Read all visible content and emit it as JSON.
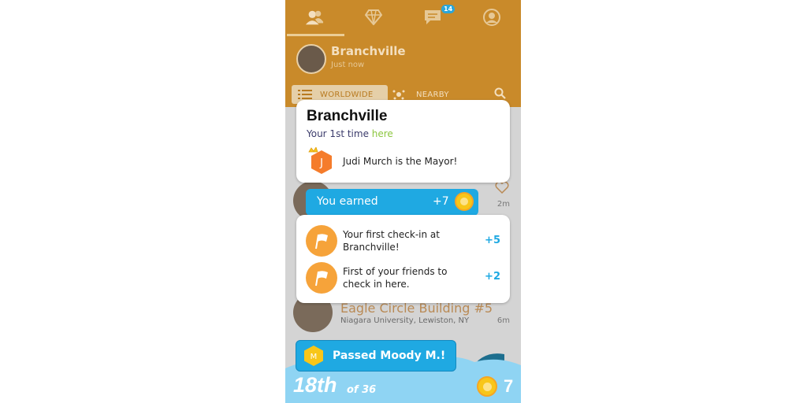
{
  "nav": {
    "tabs": [
      {
        "icon": "friends-icon"
      },
      {
        "icon": "diamond-icon"
      },
      {
        "icon": "chat-icon",
        "badge": "14"
      },
      {
        "icon": "profile-icon"
      }
    ]
  },
  "header": {
    "title": "Branchville",
    "subtitle": "Just now"
  },
  "filters": {
    "worldwide": "WORLDWIDE",
    "nearby": "NEARBY"
  },
  "feed": [
    {
      "time": "2m"
    },
    {
      "title": "Eagle Circle Building #5",
      "subtitle": "Niagara University, Lewiston, NY",
      "time": "6m"
    }
  ],
  "venue_card": {
    "name": "Branchville",
    "visit_prefix": "Your 1st time ",
    "visit_here": "here",
    "mayor_initial": "J",
    "mayor_text": "Judi Murch is the Mayor!"
  },
  "earned": {
    "label": "You earned",
    "points": "+7"
  },
  "checkins": [
    {
      "text": "Your first check-in at Branchville!",
      "points": "+5"
    },
    {
      "text": "First of your friends to check in here.",
      "points": "+2"
    }
  ],
  "passed": {
    "initial": "M",
    "label": "Passed Moody M.!"
  },
  "footer": {
    "rank": "18th",
    "of": "of 36",
    "coins": "7"
  },
  "colors": {
    "orange": "#f6a33a",
    "blue": "#1fa9e2",
    "green": "#8cc63f",
    "coin": "#f8c619"
  }
}
